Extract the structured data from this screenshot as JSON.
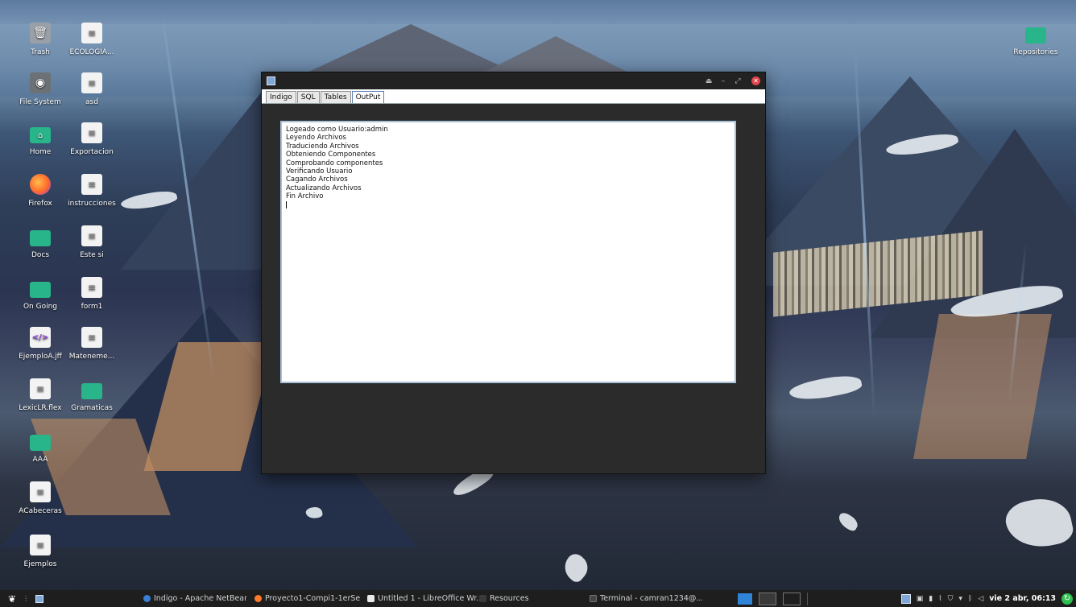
{
  "desktop": {
    "icons": [
      {
        "label": "Trash",
        "glyph": "trash-icon"
      },
      {
        "label": "ECOLOGIA...",
        "glyph": "document-icon"
      },
      {
        "label": "File System",
        "glyph": "drive-icon"
      },
      {
        "label": "asd",
        "glyph": "document-icon"
      },
      {
        "label": "Home",
        "glyph": "home-folder-icon"
      },
      {
        "label": "Exportacion",
        "glyph": "document-icon"
      },
      {
        "label": "Firefox",
        "glyph": "firefox-icon"
      },
      {
        "label": "instrucciones",
        "glyph": "document-icon"
      },
      {
        "label": "Docs",
        "glyph": "folder-icon"
      },
      {
        "label": "Este si",
        "glyph": "document-icon"
      },
      {
        "label": "On Going",
        "glyph": "folder-icon"
      },
      {
        "label": "form1",
        "glyph": "document-icon"
      },
      {
        "label": "EjemploA.jff",
        "glyph": "code-file-icon"
      },
      {
        "label": "Mateneme...",
        "glyph": "document-icon"
      },
      {
        "label": "LexicLR.flex",
        "glyph": "document-icon"
      },
      {
        "label": "Gramaticas",
        "glyph": "folder-icon"
      },
      {
        "label": "AAA",
        "glyph": "folder-icon"
      },
      {
        "label": "ACabeceras",
        "glyph": "document-icon"
      },
      {
        "label": "Ejemplos",
        "glyph": "document-icon"
      },
      {
        "label": "Repositories",
        "glyph": "folder-icon"
      }
    ]
  },
  "window": {
    "tabs": [
      "Indigo",
      "SQL",
      "Tables",
      "OutPut"
    ],
    "active_tab": "OutPut",
    "output_lines": [
      "Logeado como Usuario:admin",
      "Leyendo Archivos",
      "Traduciendo Archivos",
      "Obteniendo Componentes",
      "Comprobando componentes",
      "Verificando Usuario",
      "Cagando Archivos",
      "Actualizando Archivos",
      "Fin Archivo"
    ]
  },
  "taskbar": {
    "tasks": [
      "Indigo - Apache NetBeans...",
      "Proyecto1-Compi1-1erSe...",
      "Untitled 1 - LibreOffice Wr...",
      "Resources",
      "Terminal - camran1234@..."
    ],
    "clock": "vie 2 abr, 06:13"
  }
}
